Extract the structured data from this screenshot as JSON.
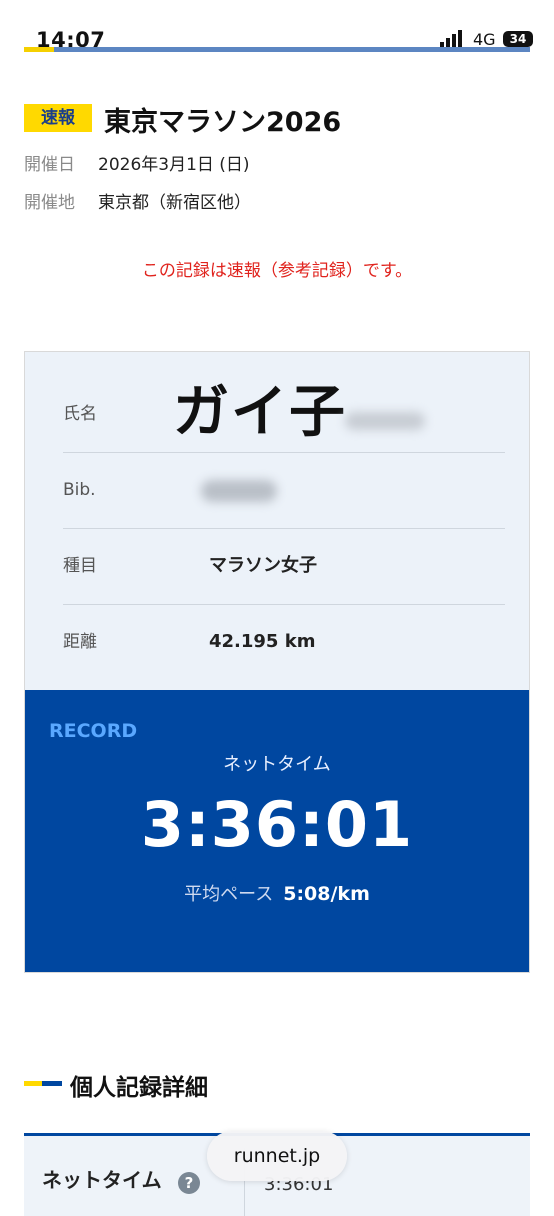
{
  "status_bar": {
    "time": "14:07",
    "network": "4G",
    "battery": "34"
  },
  "header": {
    "badge": "速報",
    "title": "東京マラソン2026",
    "date_label": "開催日",
    "date_value": "2026年3月1日 (日)",
    "venue_label": "開催地",
    "venue_value": "東京都（新宿区他）"
  },
  "notice": "この記録は速報（参考記録）です。",
  "runner": {
    "name_label": "氏名",
    "name_value": "ガイ子",
    "bib_label": "Bib.",
    "event_label": "種目",
    "event_value": "マラソン女子",
    "distance_label": "距離",
    "distance_value": "42.195 km"
  },
  "record": {
    "label": "RECORD",
    "net_time_label": "ネットタイム",
    "net_time": "3:36:01",
    "pace_label": "平均ペース",
    "pace_value": "5:08/km"
  },
  "details": {
    "title": "個人記録詳細",
    "row_label": "ネットタイム",
    "help": "?",
    "row_value": "3:36:01"
  },
  "browser": {
    "url": "runnet.jp"
  },
  "colors": {
    "accent_blue": "#0047a0",
    "brand_yellow": "#ffd900",
    "alert_red": "#e0231d"
  }
}
